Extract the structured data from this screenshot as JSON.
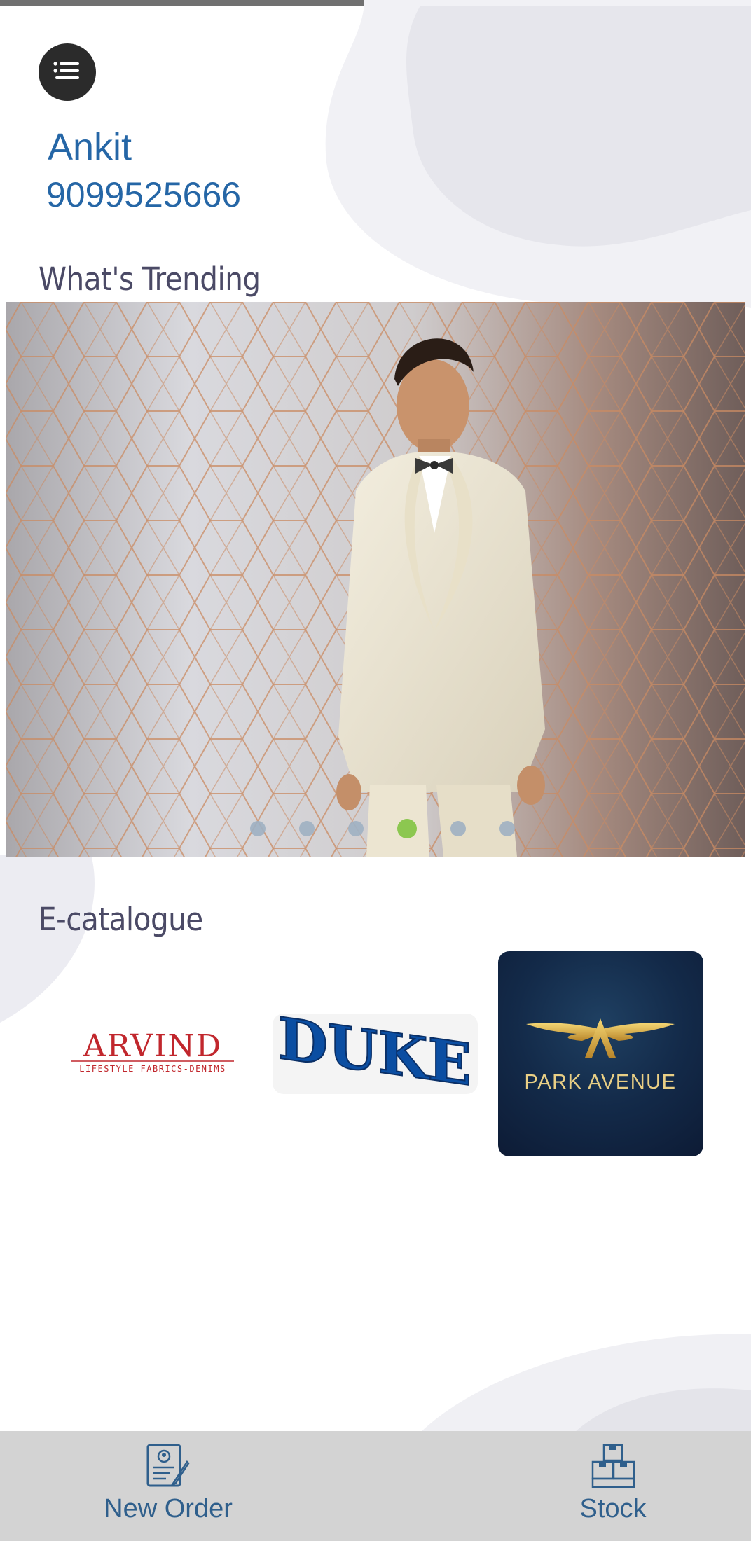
{
  "header": {
    "menu_icon": "hamburger-menu-icon",
    "user_name": "Ankit",
    "user_phone": "9099525666"
  },
  "trending": {
    "title": "What's Trending",
    "slide_count": 6,
    "active_slide": 4
  },
  "catalogue": {
    "title": "E-catalogue",
    "brands": [
      {
        "name": "Arvind",
        "logo_text": "ARVIND",
        "tagline": "LIFESTYLE FABRICS-DENIMS"
      },
      {
        "name": "Duke",
        "logo_text": "DUKE"
      },
      {
        "name": "Park Avenue",
        "logo_text": "PARK AVENUE"
      }
    ]
  },
  "bottom_nav": {
    "new_order_label": "New Order",
    "stock_label": "Stock"
  },
  "colors": {
    "accent_blue": "#2566a6",
    "title_gray": "#4b4a66",
    "active_dot": "#82c341",
    "nav_bg": "#d3d3d3"
  }
}
